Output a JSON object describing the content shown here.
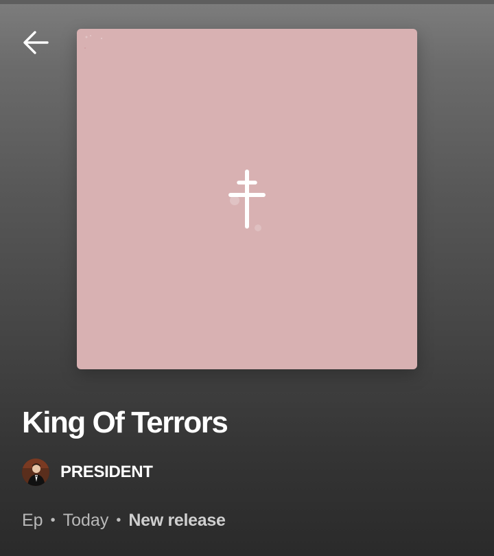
{
  "header": {
    "back_icon": "arrow-left-icon"
  },
  "album": {
    "cover_color": "#d8b1b2",
    "cover_icon": "cross-icon",
    "title": "King Of Terrors",
    "artist": {
      "name": "PRESIDENT",
      "avatar_icon": "artist-avatar"
    },
    "meta": {
      "type": "Ep",
      "separator": "•",
      "date": "Today",
      "status": "New release"
    }
  }
}
